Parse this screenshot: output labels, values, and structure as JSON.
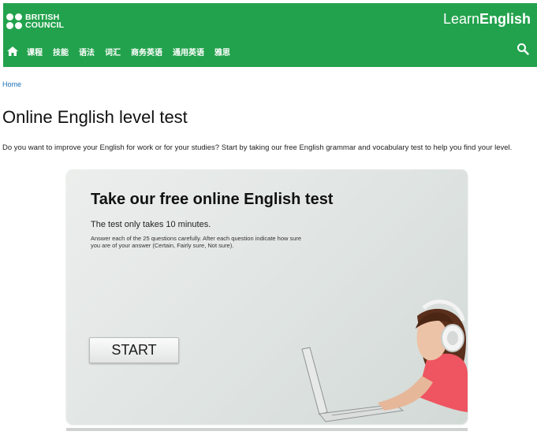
{
  "header": {
    "logo_line1": "BRITISH",
    "logo_line2": "COUNCIL",
    "brand_light": "Learn",
    "brand_bold": "English",
    "nav": [
      "课程",
      "技能",
      "语法",
      "词汇",
      "商务英语",
      "通用英语",
      "雅思"
    ],
    "icons": [
      "home-icon",
      "search-icon"
    ]
  },
  "breadcrumb": "Home",
  "title": "Online English level test",
  "intro": "Do you want to improve your English for work or for your studies? Start by taking our free English grammar and vocabulary test to help you find your level.",
  "promo": {
    "title": "Take our free online English test",
    "subtitle": "The test only takes 10 minutes.",
    "description": "Answer each of the 25 questions carefully. After each question indicate how sure you are of your answer (Certain, Fairly sure, Not sure).",
    "start_label": "START"
  },
  "colors": {
    "header_bg": "#23a24d",
    "link": "#1a70b8"
  }
}
